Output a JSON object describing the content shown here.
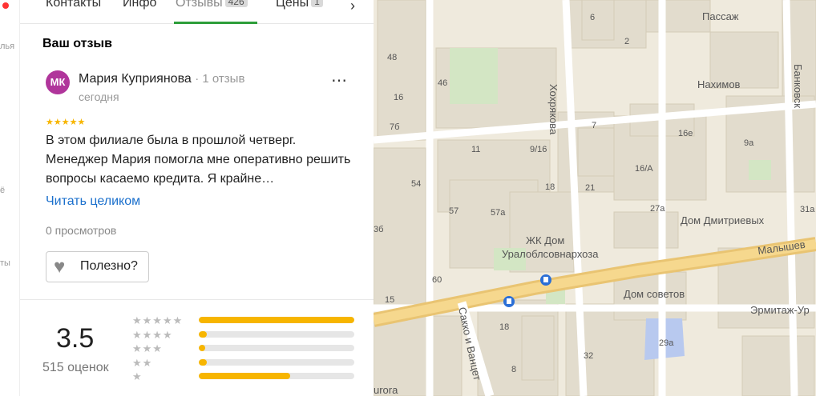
{
  "tabs": [
    {
      "label": "Контакты"
    },
    {
      "label": "Инфо"
    },
    {
      "label": "Отзывы",
      "count": "426"
    },
    {
      "label": "Цены",
      "count": "1"
    }
  ],
  "rail_fragments": [
    "лья",
    "ё",
    "ты"
  ],
  "review": {
    "section_title": "Ваш отзыв",
    "avatar_initials": "МК",
    "author": "Мария Куприянова",
    "author_meta": "· 1 отзыв",
    "date": "сегодня",
    "rating_stars": "★★★★★",
    "text": "В этом филиале была в прошлой четверг. Менеджер Мария помогла мне оперативно решить вопросы касаемо кредита. Я крайне…",
    "read_more": "Читать целиком",
    "views": "0 просмотров",
    "useful_label": "Полезно?"
  },
  "rating": {
    "score": "3.5",
    "count_label": "515 оценок",
    "rows": [
      {
        "stars": "★★★★★",
        "fraction": 1.0
      },
      {
        "stars": "★★★★",
        "fraction": 0.05
      },
      {
        "stars": "★★★",
        "fraction": 0.04
      },
      {
        "stars": "★★",
        "fraction": 0.05
      },
      {
        "stars": "★",
        "fraction": 0.59
      }
    ]
  },
  "map": {
    "labels": {
      "passazh": "Пассаж",
      "nakhimov": "Нахимов",
      "bankovsky": "Банковск",
      "khokhryakova": "Хохрякова",
      "dom_dmitrievykh": "Дом Дмитриевых",
      "malyshev": "Малышев",
      "zhk_dom": "ЖК Дом",
      "uralobl": "Уралоблсовнархоза",
      "dom_sovetov": "Дом советов",
      "ermitazh": "Эрмитаж-Ур",
      "sakko": "Сакко и Ванцет",
      "aurora": "urora"
    },
    "house_numbers": [
      "48",
      "46",
      "6",
      "2",
      "7",
      "16е",
      "9а",
      "16/А",
      "21",
      "27а",
      "31а",
      "11",
      "9/16",
      "18",
      "54",
      "57",
      "57а",
      "60",
      "15",
      "18",
      "29а",
      "32",
      "8",
      "16",
      "7б",
      "3б"
    ]
  }
}
